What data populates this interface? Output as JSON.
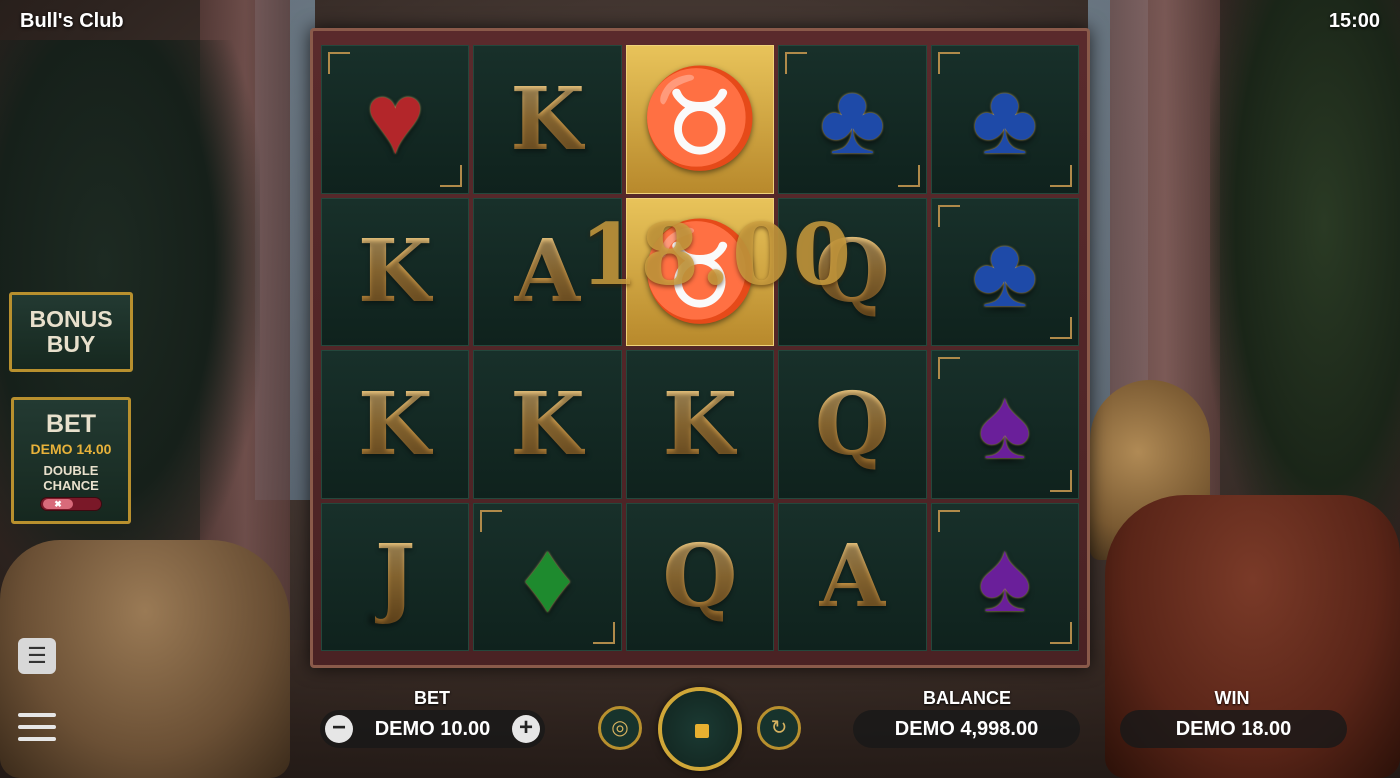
{
  "header": {
    "title": "Bull's Club",
    "clock": "15:00"
  },
  "reels": {
    "rows": [
      [
        "heart",
        "K",
        "bull",
        "club",
        "club"
      ],
      [
        "K",
        "A",
        "bull",
        "Q",
        "club"
      ],
      [
        "K",
        "K",
        "K",
        "Q",
        "spade"
      ],
      [
        "J",
        "diamond",
        "Q",
        "A",
        "spade"
      ]
    ],
    "win_overlay": "18.00"
  },
  "side": {
    "bonus_buy_line1": "BONUS",
    "bonus_buy_line2": "BUY",
    "bet_title": "BET",
    "bet_amount": "DEMO 14.00",
    "double_chance_line1": "DOUBLE",
    "double_chance_line2": "CHANCE",
    "double_chance_toggle": "✖"
  },
  "bottom": {
    "bet_label": "BET",
    "bet_value": "DEMO 10.00",
    "minus": "−",
    "plus": "+",
    "balance_label": "BALANCE",
    "balance_value": "DEMO 4,998.00",
    "win_label": "WIN",
    "win_value": "DEMO 18.00"
  },
  "icons": {
    "coins": "coins-settings-icon",
    "autoplay": "autoplay-icon",
    "paytable": "paytable-icon",
    "menu": "menu-icon"
  },
  "colors": {
    "accent_gold": "#d0a738",
    "reel_bg": "#15291f",
    "frame": "#4a2224",
    "toggle_off": "#7a1828"
  }
}
